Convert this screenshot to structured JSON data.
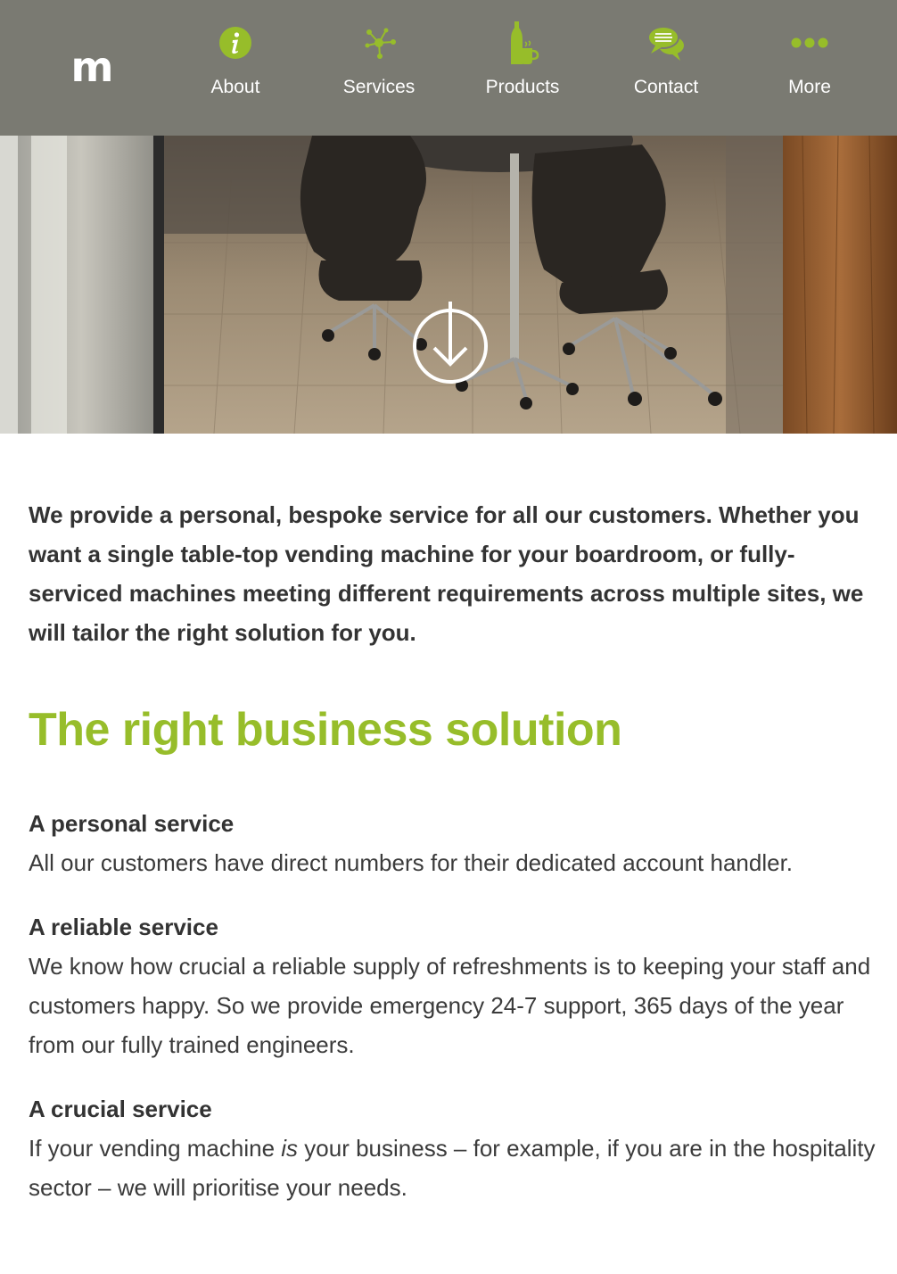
{
  "brand": {
    "logo_text": "m",
    "accent_color": "#97bd2a",
    "nav_background": "#7a7a72"
  },
  "nav": {
    "items": [
      {
        "label": "About",
        "icon": "info-icon"
      },
      {
        "label": "Services",
        "icon": "network-icon"
      },
      {
        "label": "Products",
        "icon": "bottle-cup-icon"
      },
      {
        "label": "Contact",
        "icon": "speech-bubbles-icon"
      },
      {
        "label": "More",
        "icon": "more-dots-icon"
      }
    ]
  },
  "hero": {
    "image": "meeting-room-chairs-photo",
    "scroll_icon": "arrow-down-circle-icon"
  },
  "content": {
    "intro": "We provide a personal, bespoke service for all our customers. Whether you want a single table-top vending machine for your boardroom, or fully-serviced machines meeting different requirements across multiple sites, we will tailor the right solution for you.",
    "heading": "The right business solution",
    "sections": [
      {
        "title": "A personal service",
        "body": "All our customers have direct numbers for their dedicated account handler."
      },
      {
        "title": "A reliable service",
        "body": "We know how crucial a reliable supply of refreshments is to keeping your staff and customers happy. So we provide emergency 24-7 support, 365 days of the year from our fully trained engineers."
      },
      {
        "title": "A crucial service",
        "body_before": "If your vending machine ",
        "body_emphasis": "is",
        "body_after": " your business – for example, if you are in the hospitality sector – we will prioritise your needs."
      }
    ]
  }
}
